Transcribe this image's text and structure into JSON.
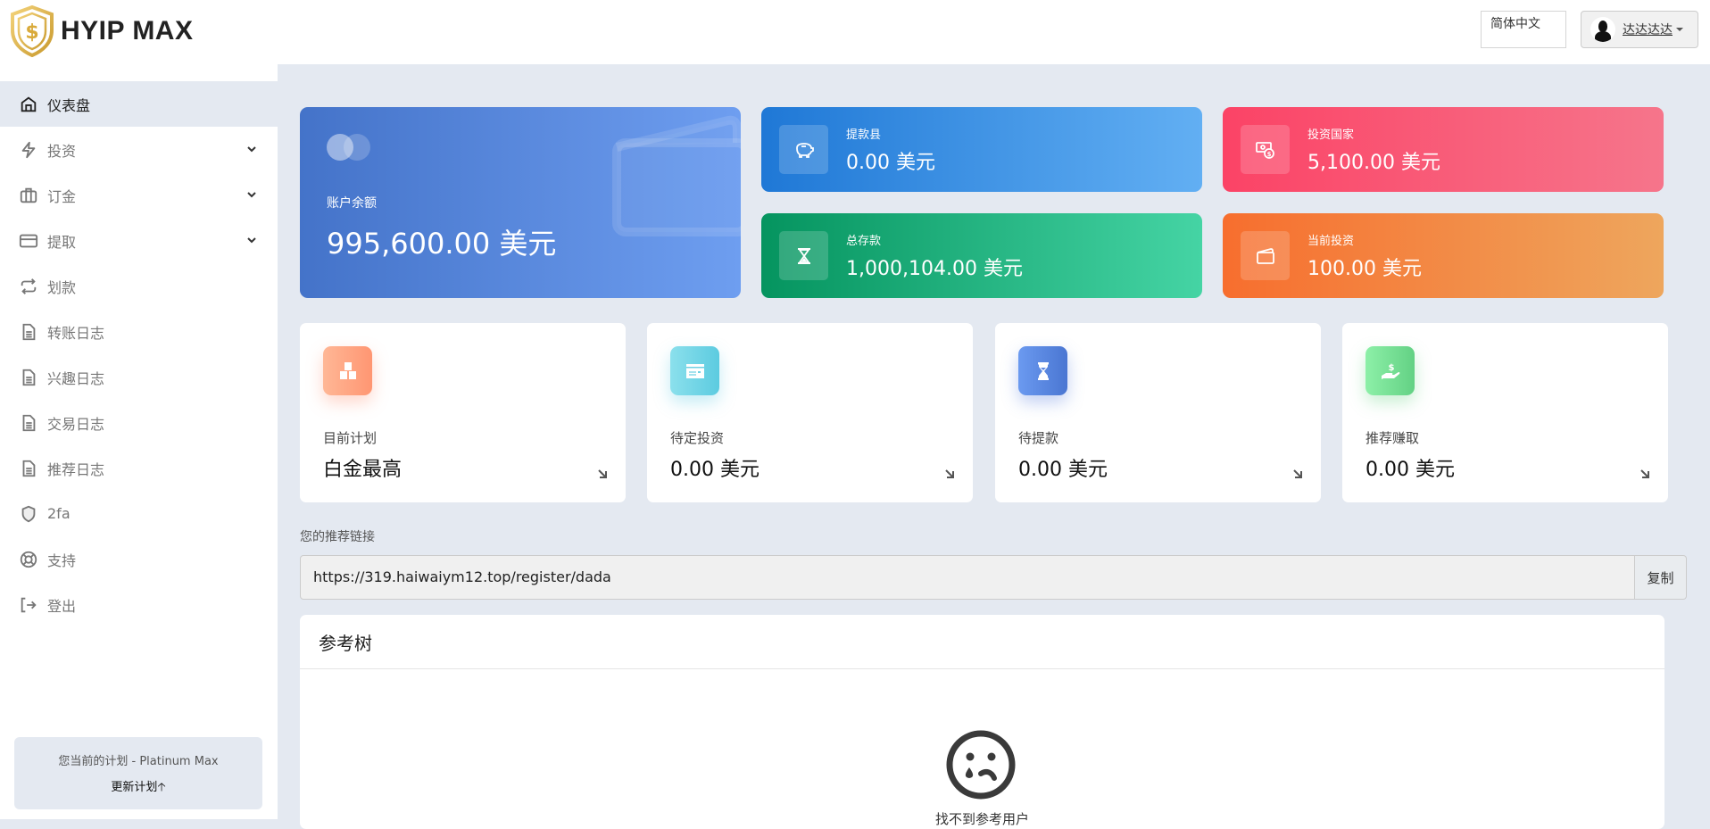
{
  "header": {
    "brand": "HYIP MAX",
    "language": "简体中文",
    "user_name": "达达达达"
  },
  "sidebar": {
    "items": [
      {
        "label": "仪表盘",
        "icon": "home-icon",
        "active": true
      },
      {
        "label": "投资",
        "icon": "bolt-icon",
        "expandable": true
      },
      {
        "label": "订金",
        "icon": "briefcase-icon",
        "expandable": true
      },
      {
        "label": "提取",
        "icon": "credit-card-icon",
        "expandable": true
      },
      {
        "label": "划款",
        "icon": "transfer-icon"
      },
      {
        "label": " 转账日志",
        "icon": "document-icon"
      },
      {
        "label": "兴趣日志",
        "icon": "document-icon"
      },
      {
        "label": "交易日志",
        "icon": "document-icon"
      },
      {
        "label": "推荐日志",
        "icon": "document-icon"
      },
      {
        "label": "2fa",
        "icon": "shield-icon"
      },
      {
        "label": "支持",
        "icon": "lifebuoy-icon"
      },
      {
        "label": "登出",
        "icon": "logout-icon"
      }
    ],
    "plan": {
      "text": "您当前的计划 - Platinum Max",
      "upgrade_label": "更新计划🡡"
    }
  },
  "balance_card": {
    "label": "账户余额",
    "value": "995,600.00 美元"
  },
  "stats": [
    {
      "label": "提款县",
      "value": "0.00 美元",
      "icon": "piggy-bank-icon",
      "gradient": [
        "#1f78d6",
        "#62aff3"
      ]
    },
    {
      "label": "投资国家",
      "value": "5,100.00 美元",
      "icon": "money-icon",
      "gradient": [
        "#fb4366",
        "#f6758b"
      ]
    },
    {
      "label": "总存款",
      "value": "1,000,104.00 美元",
      "icon": "hourglass-icon",
      "gradient": [
        "#05945f",
        "#45d4a4"
      ]
    },
    {
      "label": "当前投资",
      "value": "100.00 美元",
      "icon": "wallet-icon",
      "gradient": [
        "#f76e2e",
        "#eea65d"
      ]
    }
  ],
  "mini_cards": [
    {
      "label": "目前计划",
      "value": "白金最高",
      "icon": "boxes-icon",
      "gradient": [
        "#ffb796",
        "#ff9672"
      ]
    },
    {
      "label": "待定投资",
      "value": "0.00 美元",
      "icon": "bill-icon",
      "gradient": [
        "#8be0ec",
        "#5ccbe0"
      ]
    },
    {
      "label": "待提款",
      "value": "0.00 美元",
      "icon": "hourglass-icon",
      "gradient": [
        "#6b9af0",
        "#4a76d2"
      ]
    },
    {
      "label": "推荐赚取",
      "value": "0.00 美元",
      "icon": "hand-dollar-icon",
      "gradient": [
        "#8df0a8",
        "#63d184"
      ]
    }
  ],
  "referral": {
    "label": "您的推荐链接",
    "link": "https://319.haiwaiym12.top/register/dada",
    "copy_label": "复制"
  },
  "tree": {
    "title": "参考树",
    "empty_text": "找不到参考用户"
  }
}
